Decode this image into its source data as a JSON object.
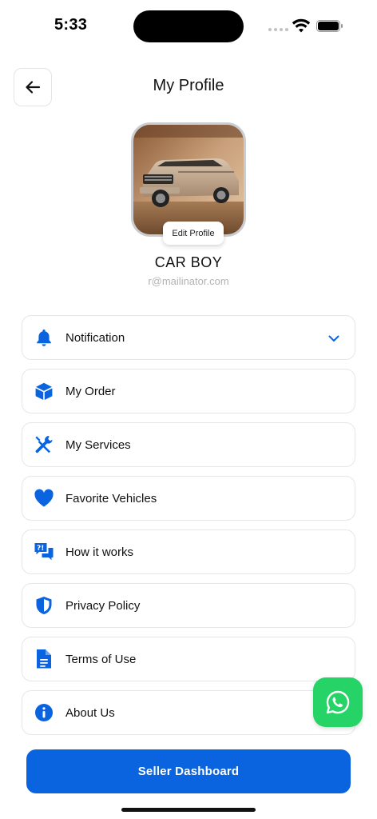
{
  "status_bar": {
    "time": "5:33"
  },
  "header": {
    "title": "My Profile",
    "back_icon": "arrow-left-icon"
  },
  "profile": {
    "edit_label": "Edit Profile",
    "name": "CAR BOY",
    "email": "r@mailinator.com"
  },
  "colors": {
    "accent": "#0A64E0",
    "whatsapp": "#25D366"
  },
  "menu": {
    "items": [
      {
        "label": "Notification",
        "icon": "bell-icon",
        "expandable": true
      },
      {
        "label": "My Order",
        "icon": "box-icon"
      },
      {
        "label": "My Services",
        "icon": "tools-icon"
      },
      {
        "label": "Favorite Vehicles",
        "icon": "heart-icon"
      },
      {
        "label": "How it works",
        "icon": "question-chat-icon"
      },
      {
        "label": "Privacy Policy",
        "icon": "shield-icon"
      },
      {
        "label": "Terms of Use",
        "icon": "document-icon"
      },
      {
        "label": "About Us",
        "icon": "info-icon"
      }
    ]
  },
  "actions": {
    "whatsapp_icon": "whatsapp-icon",
    "seller_dashboard": "Seller Dashboard"
  }
}
